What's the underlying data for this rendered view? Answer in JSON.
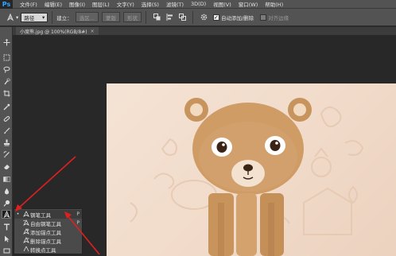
{
  "app": {
    "logo": "Ps"
  },
  "menu": [
    "文件(F)",
    "编辑(E)",
    "图像(I)",
    "图层(L)",
    "文字(Y)",
    "选择(S)",
    "滤镜(T)",
    "3D(D)",
    "视图(V)",
    "窗口(W)",
    "帮助(H)"
  ],
  "options": {
    "mode_value": "路径",
    "build_label": "建立：",
    "select_button": "选区...",
    "mask_button": "蒙版",
    "shape_button": "形状",
    "auto_add_delete_label": "自动添加/删除",
    "auto_add_delete_checked": true,
    "align_edges_label": "对齐边缘"
  },
  "document": {
    "tab_title": "小度熊.jpg @ 100%(RGB/8#)",
    "close_glyph": "×"
  },
  "flyout": {
    "items": [
      {
        "label": "钢笔工具",
        "shortcut": "P",
        "selected": true,
        "check": "•"
      },
      {
        "label": "自由钢笔工具",
        "shortcut": "P",
        "selected": false,
        "check": ""
      },
      {
        "label": "添加锚点工具",
        "shortcut": "",
        "selected": false,
        "check": ""
      },
      {
        "label": "删除锚点工具",
        "shortcut": "",
        "selected": false,
        "check": ""
      },
      {
        "label": "转换点工具",
        "shortcut": "",
        "selected": false,
        "check": ""
      }
    ]
  },
  "icons": {
    "pen": "pen-icon",
    "accent_arrow_color": "#e02020"
  }
}
